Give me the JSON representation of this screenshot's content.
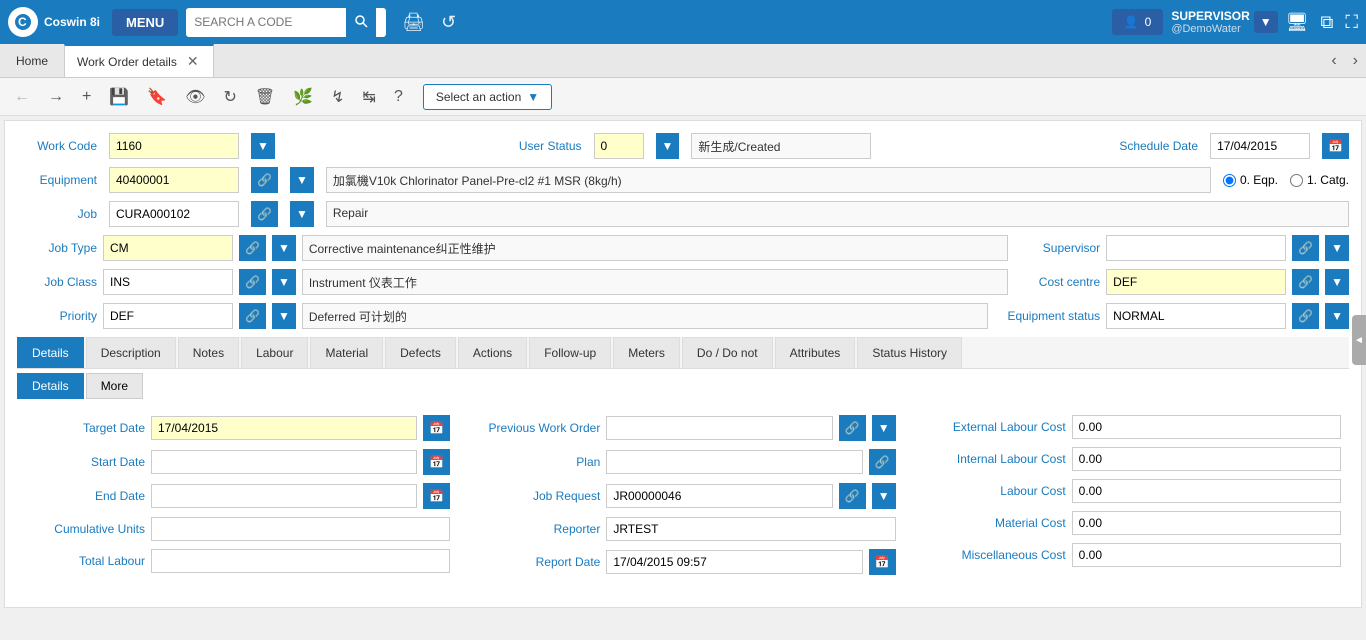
{
  "app": {
    "name": "Coswin 8i",
    "menu_label": "MENU"
  },
  "search": {
    "placeholder": "SEARCH A CODE"
  },
  "notifications": {
    "count": "0"
  },
  "user": {
    "role": "SUPERVISOR",
    "username": "@DemoWater"
  },
  "tabs": {
    "home": "Home",
    "active": "Work Order details"
  },
  "toolbar": {
    "action_label": "Select an action"
  },
  "form": {
    "work_code_label": "Work Code",
    "work_code_value": "1160",
    "user_status_label": "User Status",
    "user_status_value": "0",
    "user_status_text": "新生成/Created",
    "schedule_date_label": "Schedule Date",
    "schedule_date_value": "17/04/2015",
    "equipment_label": "Equipment",
    "equipment_code": "40400001",
    "equipment_desc": "加氯機V10k Chlorinator Panel-Pre-cl2 #1 MSR (8kg/h)",
    "eqp_option": "0. Eqp.",
    "catg_option": "1. Catg.",
    "job_label": "Job",
    "job_code": "CURA000102",
    "job_desc": "Repair",
    "job_type_label": "Job Type",
    "job_type_code": "CM",
    "job_type_desc": "Corrective maintenance纠正性维护",
    "supervisor_label": "Supervisor",
    "supervisor_value": "",
    "job_class_label": "Job Class",
    "job_class_code": "INS",
    "job_class_desc": "Instrument 仪表工作",
    "cost_centre_label": "Cost centre",
    "cost_centre_value": "DEF",
    "priority_label": "Priority",
    "priority_code": "DEF",
    "priority_desc": "Deferred 可计划的",
    "equipment_status_label": "Equipment status",
    "equipment_status_value": "NORMAL"
  },
  "section_tabs": [
    "Details",
    "Description",
    "Notes",
    "Labour",
    "Material",
    "Defects",
    "Actions",
    "Follow-up",
    "Meters",
    "Do / Do not",
    "Attributes",
    "Status History"
  ],
  "sub_tabs": [
    "Details",
    "More"
  ],
  "details": {
    "target_date_label": "Target Date",
    "target_date_value": "17/04/2015",
    "start_date_label": "Start Date",
    "start_date_value": "",
    "end_date_label": "End Date",
    "end_date_value": "",
    "cumulative_units_label": "Cumulative Units",
    "cumulative_units_value": "",
    "total_labour_label": "Total Labour",
    "prev_work_order_label": "Previous Work Order",
    "prev_work_order_value": "",
    "plan_label": "Plan",
    "plan_value": "",
    "job_request_label": "Job Request",
    "job_request_value": "JR00000046",
    "reporter_label": "Reporter",
    "reporter_value": "JRTEST",
    "report_date_label": "Report Date",
    "report_date_value": "17/04/2015 09:57",
    "ext_labour_cost_label": "External Labour Cost",
    "ext_labour_cost_value": "0.00",
    "int_labour_cost_label": "Internal Labour Cost",
    "int_labour_cost_value": "0.00",
    "labour_cost_label": "Labour Cost",
    "labour_cost_value": "0.00",
    "material_cost_label": "Material Cost",
    "material_cost_value": "0.00",
    "misc_cost_label": "Miscellaneous Cost",
    "misc_cost_value": "0.00"
  }
}
